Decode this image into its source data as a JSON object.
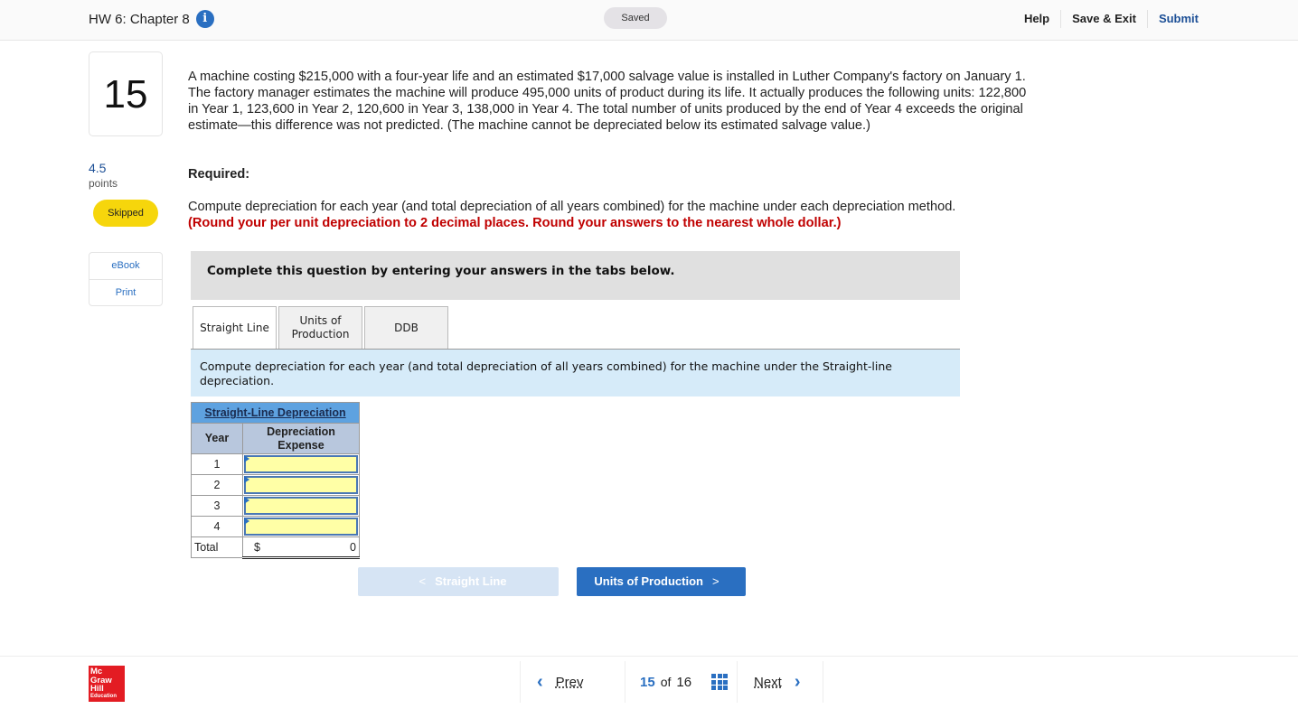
{
  "header": {
    "title": "HW 6: Chapter 8",
    "info_icon": "info-icon",
    "saved_label": "Saved",
    "links": {
      "help": "Help",
      "save_exit": "Save & Exit",
      "submit": "Submit"
    }
  },
  "sidebar": {
    "question_number": "15",
    "points_value": "4.5",
    "points_label": "points",
    "status": "Skipped",
    "links": [
      {
        "label": "eBook"
      },
      {
        "label": "Print"
      }
    ]
  },
  "question": {
    "text": "A machine costing $215,000 with a four-year life and an estimated $17,000 salvage value is installed in Luther Company's factory on January 1. The factory manager estimates the machine will produce 495,000 units of product during its life. It actually produces the following units: 122,800 in Year 1, 123,600 in Year 2, 120,600 in Year 3, 138,000 in Year 4. The total number of units produced by the end of Year 4 exceeds the original estimate—this difference was not predicted. (The machine cannot be depreciated below its estimated salvage value.)",
    "required_label": "Required:",
    "instruction": "Compute depreciation for each year (and total depreciation of all years combined) for the machine under each depreciation method.",
    "rounding_note": "(Round your per unit depreciation to 2 decimal places. Round your answers to the nearest whole dollar.)"
  },
  "answer_area": {
    "banner": "Complete this question by entering your answers in the tabs below.",
    "tabs": [
      {
        "label": "Straight Line",
        "active": true
      },
      {
        "label": "Units of Production",
        "active": false
      },
      {
        "label": "DDB",
        "active": false
      }
    ],
    "tab_description": "Compute depreciation for each year (and total depreciation of all years combined) for the machine under the Straight-line depreciation."
  },
  "table": {
    "title": "Straight-Line Depreciation",
    "headers": {
      "year": "Year",
      "expense": "Depreciation Expense"
    },
    "rows": [
      {
        "year": "1",
        "value": ""
      },
      {
        "year": "2",
        "value": ""
      },
      {
        "year": "3",
        "value": ""
      },
      {
        "year": "4",
        "value": ""
      }
    ],
    "total": {
      "label": "Total",
      "currency": "$",
      "value": "0"
    }
  },
  "nav_buttons": {
    "prev": {
      "label": "Straight Line",
      "disabled": true
    },
    "next": {
      "label": "Units of Production"
    }
  },
  "footer": {
    "logo": [
      "Mc",
      "Graw",
      "Hill",
      "Education"
    ],
    "prev_label": "Prev",
    "current_page": "15",
    "of_label": "of",
    "total_pages": "16",
    "next_label": "Next"
  }
}
